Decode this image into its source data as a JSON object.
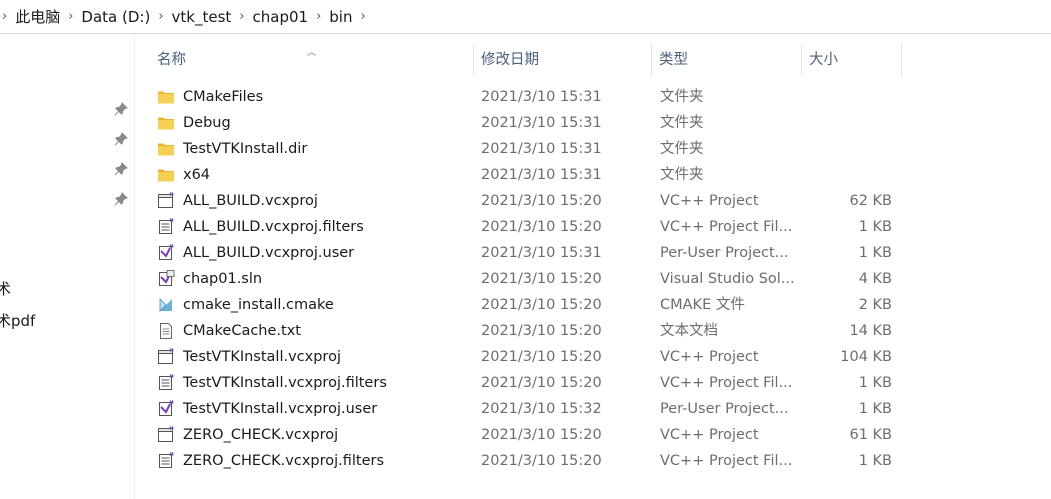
{
  "breadcrumb": [
    "此电脑",
    "Data (D:)",
    "vtk_test",
    "chap01",
    "bin"
  ],
  "nav": {
    "items": [
      "术",
      "术pdf"
    ]
  },
  "columns": {
    "name": "名称",
    "date": "修改日期",
    "type": "类型",
    "size": "大小"
  },
  "files": [
    {
      "name": "CMakeFiles",
      "date": "2021/3/10 15:31",
      "type": "文件夹",
      "size": "",
      "icon": "folder-icon"
    },
    {
      "name": "Debug",
      "date": "2021/3/10 15:31",
      "type": "文件夹",
      "size": "",
      "icon": "folder-icon"
    },
    {
      "name": "TestVTKInstall.dir",
      "date": "2021/3/10 15:31",
      "type": "文件夹",
      "size": "",
      "icon": "folder-icon"
    },
    {
      "name": "x64",
      "date": "2021/3/10 15:31",
      "type": "文件夹",
      "size": "",
      "icon": "folder-icon"
    },
    {
      "name": "ALL_BUILD.vcxproj",
      "date": "2021/3/10 15:20",
      "type": "VC++ Project",
      "size": "62 KB",
      "icon": "vcxproj-icon"
    },
    {
      "name": "ALL_BUILD.vcxproj.filters",
      "date": "2021/3/10 15:20",
      "type": "VC++ Project Fil...",
      "size": "1 KB",
      "icon": "vcxproj-filters-icon"
    },
    {
      "name": "ALL_BUILD.vcxproj.user",
      "date": "2021/3/10 15:31",
      "type": "Per-User Project...",
      "size": "1 KB",
      "icon": "vcxproj-user-icon"
    },
    {
      "name": "chap01.sln",
      "date": "2021/3/10 15:20",
      "type": "Visual Studio Sol...",
      "size": "4 KB",
      "icon": "sln-icon"
    },
    {
      "name": "cmake_install.cmake",
      "date": "2021/3/10 15:20",
      "type": "CMAKE 文件",
      "size": "2 KB",
      "icon": "cmake-icon"
    },
    {
      "name": "CMakeCache.txt",
      "date": "2021/3/10 15:20",
      "type": "文本文档",
      "size": "14 KB",
      "icon": "text-file-icon"
    },
    {
      "name": "TestVTKInstall.vcxproj",
      "date": "2021/3/10 15:20",
      "type": "VC++ Project",
      "size": "104 KB",
      "icon": "vcxproj-icon"
    },
    {
      "name": "TestVTKInstall.vcxproj.filters",
      "date": "2021/3/10 15:20",
      "type": "VC++ Project Fil...",
      "size": "1 KB",
      "icon": "vcxproj-filters-icon"
    },
    {
      "name": "TestVTKInstall.vcxproj.user",
      "date": "2021/3/10 15:32",
      "type": "Per-User Project...",
      "size": "1 KB",
      "icon": "vcxproj-user-icon"
    },
    {
      "name": "ZERO_CHECK.vcxproj",
      "date": "2021/3/10 15:20",
      "type": "VC++ Project",
      "size": "61 KB",
      "icon": "vcxproj-icon"
    },
    {
      "name": "ZERO_CHECK.vcxproj.filters",
      "date": "2021/3/10 15:20",
      "type": "VC++ Project Fil...",
      "size": "1 KB",
      "icon": "vcxproj-filters-icon"
    }
  ],
  "colors": {
    "folder": "#f3c73e",
    "header_text": "#4c607a",
    "vs_purple": "#7b3fb7"
  }
}
